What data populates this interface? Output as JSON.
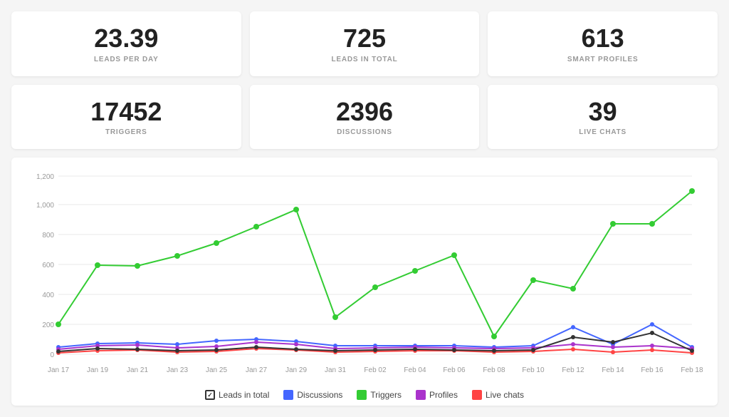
{
  "stats": [
    {
      "id": "leads-per-day",
      "value": "23.39",
      "label": "LEADS PER DAY"
    },
    {
      "id": "leads-in-total",
      "value": "725",
      "label": "LEADS IN TOTAL"
    },
    {
      "id": "smart-profiles",
      "value": "613",
      "label": "SMART PROFILES"
    },
    {
      "id": "triggers",
      "value": "17452",
      "label": "TRIGGERS"
    },
    {
      "id": "discussions",
      "value": "2396",
      "label": "DISCUSSIONS"
    },
    {
      "id": "live-chats",
      "value": "39",
      "label": "LIVE CHATS"
    }
  ],
  "chart": {
    "xLabels": [
      "Jan 17",
      "Jan 19",
      "Jan 21",
      "Jan 23",
      "Jan 25",
      "Jan 27",
      "Jan 29",
      "Jan 31",
      "Feb 02",
      "Feb 04",
      "Feb 06",
      "Feb 08",
      "Feb 10",
      "Feb 12",
      "Feb 14",
      "Feb 16",
      "Feb 18"
    ],
    "yLabels": [
      "0",
      "200",
      "400",
      "600",
      "800",
      "1,000",
      "1,200"
    ]
  },
  "legend": [
    {
      "id": "leads-in-total",
      "label": "Leads in total",
      "color": "#333",
      "type": "check"
    },
    {
      "id": "discussions",
      "label": "Discussions",
      "color": "#4466ff",
      "type": "square"
    },
    {
      "id": "triggers",
      "label": "Triggers",
      "color": "#33cc33",
      "type": "square"
    },
    {
      "id": "profiles",
      "label": "Profiles",
      "color": "#aa33cc",
      "type": "square"
    },
    {
      "id": "live-chats",
      "label": "Live chats",
      "color": "#ff4444",
      "type": "square"
    }
  ]
}
